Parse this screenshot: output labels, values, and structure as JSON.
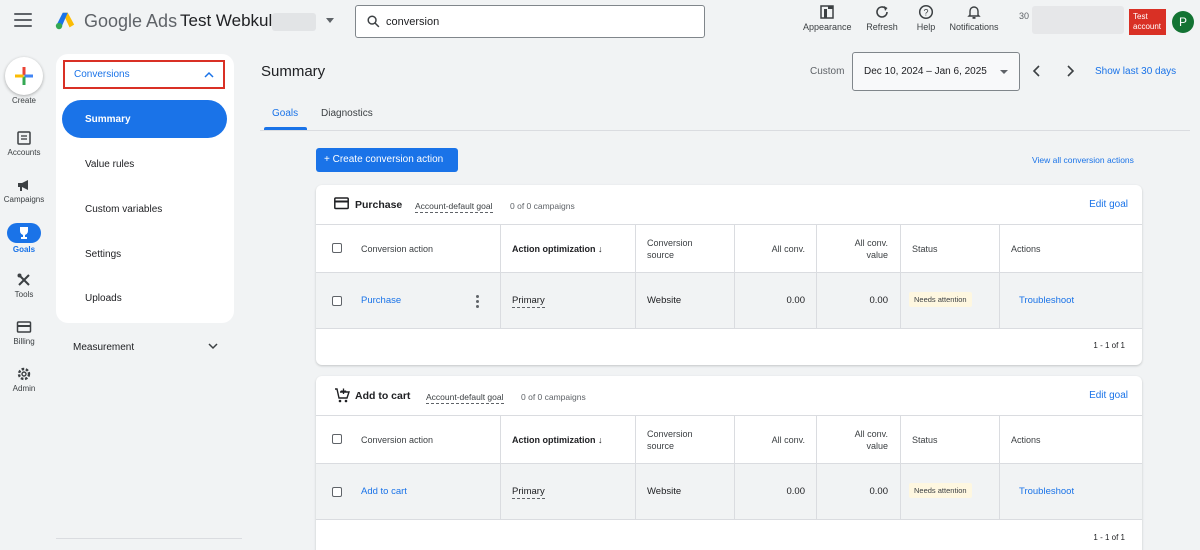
{
  "header": {
    "brand": "Google Ads",
    "account_name": "Test Webkul",
    "search": {
      "value": "conversion",
      "placeholder": ""
    },
    "actions": [
      {
        "label": "Appearance",
        "icon": "appearance-icon"
      },
      {
        "label": "Refresh",
        "icon": "refresh-icon"
      },
      {
        "label": "Help",
        "icon": "help-icon"
      },
      {
        "label": "Notifications",
        "icon": "bell-icon"
      }
    ],
    "customer_id_prefix": "30",
    "test_badge": "Test account",
    "avatar_initial": "P"
  },
  "rail": {
    "create_label": "Create",
    "items": [
      {
        "label": "Accounts",
        "icon": "accounts-icon"
      },
      {
        "label": "Campaigns",
        "icon": "megaphone-icon"
      },
      {
        "label": "Goals",
        "icon": "trophy-icon",
        "active": true
      },
      {
        "label": "Tools",
        "icon": "tools-icon"
      },
      {
        "label": "Billing",
        "icon": "credit-card-icon"
      },
      {
        "label": "Admin",
        "icon": "gear-icon"
      }
    ]
  },
  "nav": {
    "section_label": "Conversions",
    "items": [
      {
        "label": "Summary",
        "active": true
      },
      {
        "label": "Value rules"
      },
      {
        "label": "Custom variables"
      },
      {
        "label": "Settings"
      },
      {
        "label": "Uploads"
      }
    ],
    "measurement_label": "Measurement"
  },
  "main": {
    "title": "Summary",
    "range_label": "Custom",
    "date_range": "Dec 10, 2024 – Jan 6, 2025",
    "show_last": "Show last 30 days",
    "tabs": [
      {
        "label": "Goals",
        "active": true
      },
      {
        "label": "Diagnostics"
      }
    ],
    "create_button": "+ Create conversion action",
    "view_all": "View all conversion actions",
    "columns": {
      "action": "Conversion action",
      "optimization": "Action optimization",
      "source_line1": "Conversion",
      "source_line2": "source",
      "all_conv": "All conv.",
      "value_line1": "All conv.",
      "value_line2": "value",
      "status": "Status",
      "actions": "Actions"
    },
    "goals": [
      {
        "title": "Purchase",
        "icon": "credit-card-icon",
        "goal_tag": "Account-default goal",
        "campaigns": "0 of 0 campaigns",
        "edit_label": "Edit goal",
        "row": {
          "action": "Purchase",
          "optimization": "Primary",
          "source": "Website",
          "all_conv": "0.00",
          "all_conv_value": "0.00",
          "status": "Needs attention",
          "action_link": "Troubleshoot"
        },
        "pager": "1 - 1 of 1"
      },
      {
        "title": "Add to cart",
        "icon": "add-cart-icon",
        "goal_tag": "Account-default goal",
        "campaigns": "0 of 0 campaigns",
        "edit_label": "Edit goal",
        "row": {
          "action": "Add to cart",
          "optimization": "Primary",
          "source": "Website",
          "all_conv": "0.00",
          "all_conv_value": "0.00",
          "status": "Needs attention",
          "action_link": "Troubleshoot"
        },
        "pager": "1 - 1 of 1"
      }
    ]
  },
  "colors": {
    "accent": "#1a73e8",
    "danger": "#d93025",
    "warning_bg": "#fef7e0",
    "avatar": "#137333"
  }
}
